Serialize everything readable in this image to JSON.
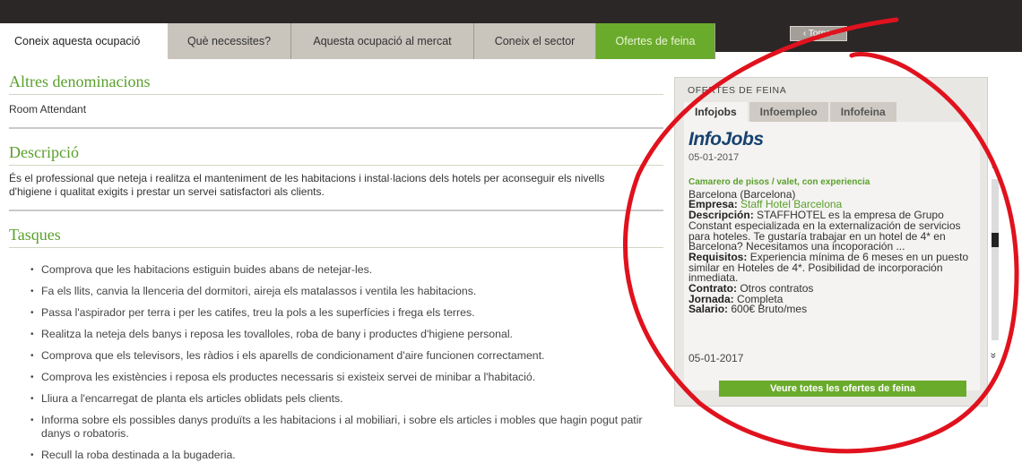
{
  "tabs": [
    {
      "label": "Coneix aquesta ocupació"
    },
    {
      "label": "Què necessites?"
    },
    {
      "label": "Aquesta ocupació al mercat"
    },
    {
      "label": "Coneix el sector"
    },
    {
      "label": "Ofertes de feina"
    }
  ],
  "back_button": "‹ Tornar",
  "sections": {
    "altres": {
      "title": "Altres denominacions",
      "text": "Room Attendant"
    },
    "descripcio": {
      "title": "Descripció",
      "text": "És el professional que neteja i realitza el manteniment de les habitacions i instal·lacions dels hotels per aconseguir els nivells d'higiene i qualitat exigits i prestar un servei satisfactori als clients."
    },
    "tasques": {
      "title": "Tasques",
      "items": [
        "Comprova que les habitacions estiguin buides abans de netejar-les.",
        "Fa els llits, canvia la llenceria del dormitori, aireja els matalassos i ventila les habitacions.",
        "Passa l'aspirador per terra i per les catifes, treu la pols a les superfícies i frega els terres.",
        "Realitza la neteja dels banys i reposa les tovalloles, roba de bany i productes d'higiene personal.",
        "Comprova que els televisors, les ràdios i els aparells de condicionament d'aire funcionen correctament.",
        "Comprova les existències i reposa els productes necessaris si existeix servei de minibar a l'habitació.",
        "Lliura a l'encarregat de planta els articles oblidats pels clients.",
        "Informa sobre els possibles danys produïts a les habitacions i al mobiliari, i sobre els articles i mobles que hagin pogut patir danys o robatoris.",
        "Recull la roba destinada a la bugaderia."
      ]
    }
  },
  "jobs": {
    "header": "OFERTES DE FEINA",
    "tabs": [
      "Infojobs",
      "Infoempleo",
      "Infofeina"
    ],
    "logo": "InfoJobs",
    "date_top": "05-01-2017",
    "job_title": "Camarero de pisos / valet, con experiencia",
    "location": "Barcelona (Barcelona)",
    "empresa_label": "Empresa:",
    "empresa_value": "Staff Hotel Barcelona",
    "descripcion_label": "Descripción:",
    "descripcion_value": "STAFFHOTEL es la empresa de Grupo Constant especializada en la externalización de servicios para hoteles. Te gustaría trabajar en un hotel de 4* en Barcelona? Necesitamos una incoporación ...",
    "requisitos_label": "Requisitos:",
    "requisitos_value": "Experiencia mínima de 6 meses en un puesto similar en Hoteles de 4*. Posibilidad de incorporación inmediata.",
    "contrato_label": "Contrato:",
    "contrato_value": "Otros contratos",
    "jornada_label": "Jornada:",
    "jornada_value": "Completa",
    "salario_label": "Salario:",
    "salario_value": "600€ Bruto/mes",
    "date_bottom": "05-01-2017",
    "view_all": "Veure totes les ofertes de feina",
    "scroll_up": "»",
    "scroll_down": "»"
  },
  "colors": {
    "green": "#6aab2c",
    "annotation_red": "#e0121d",
    "dark_bar": "#2b2727"
  }
}
